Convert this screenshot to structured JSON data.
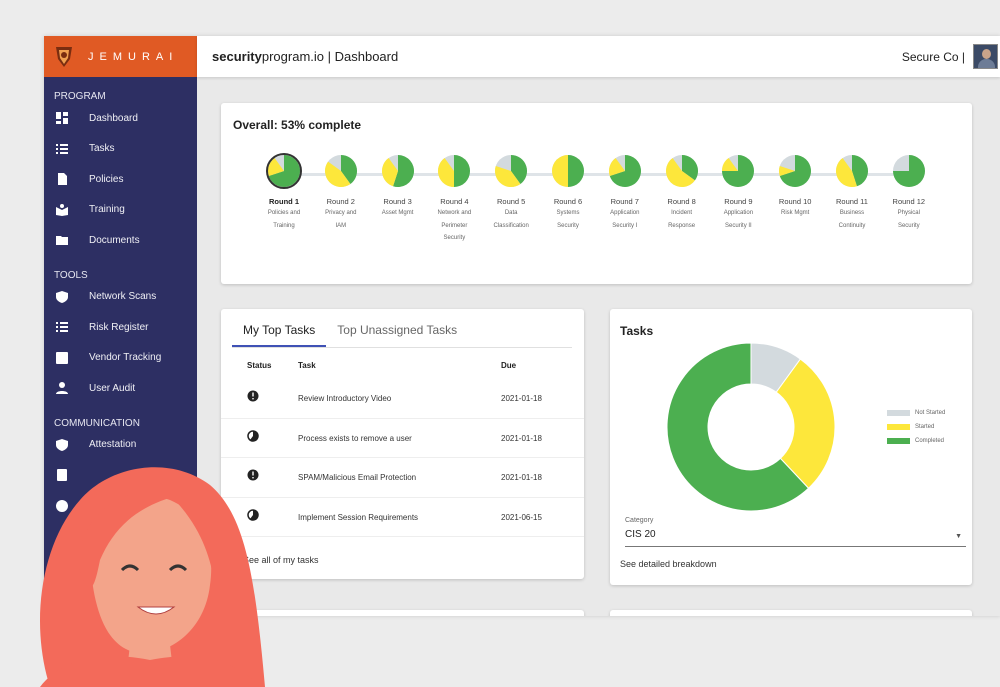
{
  "brand": {
    "name": "JEMURAI",
    "color": "#e05a24"
  },
  "topbar": {
    "title_bold": "security",
    "title_rest": "program.io | Dashboard",
    "org": "Secure Co |"
  },
  "sidebar": {
    "sections": [
      {
        "label": "PROGRAM",
        "items": [
          {
            "label": "Dashboard",
            "icon": "dashboard-icon"
          },
          {
            "label": "Tasks",
            "icon": "list-icon"
          },
          {
            "label": "Policies",
            "icon": "document-icon"
          },
          {
            "label": "Training",
            "icon": "book-icon"
          },
          {
            "label": "Documents",
            "icon": "folder-icon"
          }
        ]
      },
      {
        "label": "TOOLS",
        "items": [
          {
            "label": "Network Scans",
            "icon": "shield-icon"
          },
          {
            "label": "Risk Register",
            "icon": "list-icon"
          },
          {
            "label": "Vendor Tracking",
            "icon": "chart-icon"
          },
          {
            "label": "User Audit",
            "icon": "person-icon"
          }
        ]
      },
      {
        "label": "COMMUNICATION",
        "items": [
          {
            "label": "Attestation",
            "icon": "check-shield-icon"
          },
          {
            "label": "",
            "icon": "calculator-icon"
          },
          {
            "label": "",
            "icon": "help-icon"
          }
        ]
      }
    ]
  },
  "progress": {
    "title": "Overall: 53% complete",
    "overall_percent": 53,
    "rounds": [
      {
        "name": "Round 1",
        "desc": [
          "Policies and",
          "Training"
        ],
        "complete": 0.7,
        "started": 0.2
      },
      {
        "name": "Round 2",
        "desc": [
          "Privacy and",
          "IAM"
        ],
        "complete": 0.4,
        "started": 0.45
      },
      {
        "name": "Round 3",
        "desc": [
          "Asset Mgmt"
        ],
        "complete": 0.55,
        "started": 0.35
      },
      {
        "name": "Round 4",
        "desc": [
          "Network and",
          "Perimeter",
          "Security"
        ],
        "complete": 0.5,
        "started": 0.4
      },
      {
        "name": "Round 5",
        "desc": [
          "Data",
          "Classification"
        ],
        "complete": 0.4,
        "started": 0.4
      },
      {
        "name": "Round 6",
        "desc": [
          "Systems",
          "Security"
        ],
        "complete": 0.5,
        "started": 0.5
      },
      {
        "name": "Round 7",
        "desc": [
          "Application",
          "Security I"
        ],
        "complete": 0.7,
        "started": 0.2
      },
      {
        "name": "Round 8",
        "desc": [
          "Incident",
          "Response"
        ],
        "complete": 0.35,
        "started": 0.55
      },
      {
        "name": "Round 9",
        "desc": [
          "Application",
          "Security II"
        ],
        "complete": 0.75,
        "started": 0.15
      },
      {
        "name": "Round 10",
        "desc": [
          "Risk Mgmt"
        ],
        "complete": 0.7,
        "started": 0.1
      },
      {
        "name": "Round 11",
        "desc": [
          "Business",
          "Continuity"
        ],
        "complete": 0.45,
        "started": 0.45
      },
      {
        "name": "Round 12",
        "desc": [
          "Physical",
          "Security"
        ],
        "complete": 0.75,
        "started": 0.0
      }
    ]
  },
  "tasks": {
    "tabs": [
      "My Top Tasks",
      "Top Unassigned Tasks"
    ],
    "headers": {
      "status": "Status",
      "task": "Task",
      "due": "Due"
    },
    "rows": [
      {
        "status": "not-started",
        "task": "Review Introductory Video",
        "due": "2021-01-18"
      },
      {
        "status": "in-progress",
        "task": "Process exists to remove a user",
        "due": "2021-01-18"
      },
      {
        "status": "not-started",
        "task": "SPAM/Malicious Email Protection",
        "due": "2021-01-18"
      },
      {
        "status": "in-progress",
        "task": "Implement Session Requirements",
        "due": "2021-06-15"
      }
    ],
    "footer": "See all of my tasks"
  },
  "donut": {
    "title": "Tasks",
    "category_label": "Category",
    "category_value": "CIS 20",
    "breakdown_link": "See detailed breakdown",
    "legend": [
      {
        "label": "Not Started",
        "color": "#d3dade",
        "fraction": 0.1
      },
      {
        "label": "Started",
        "color": "#fde73b",
        "fraction": 0.28
      },
      {
        "label": "Completed",
        "color": "#4caf50",
        "fraction": 0.62
      }
    ]
  }
}
